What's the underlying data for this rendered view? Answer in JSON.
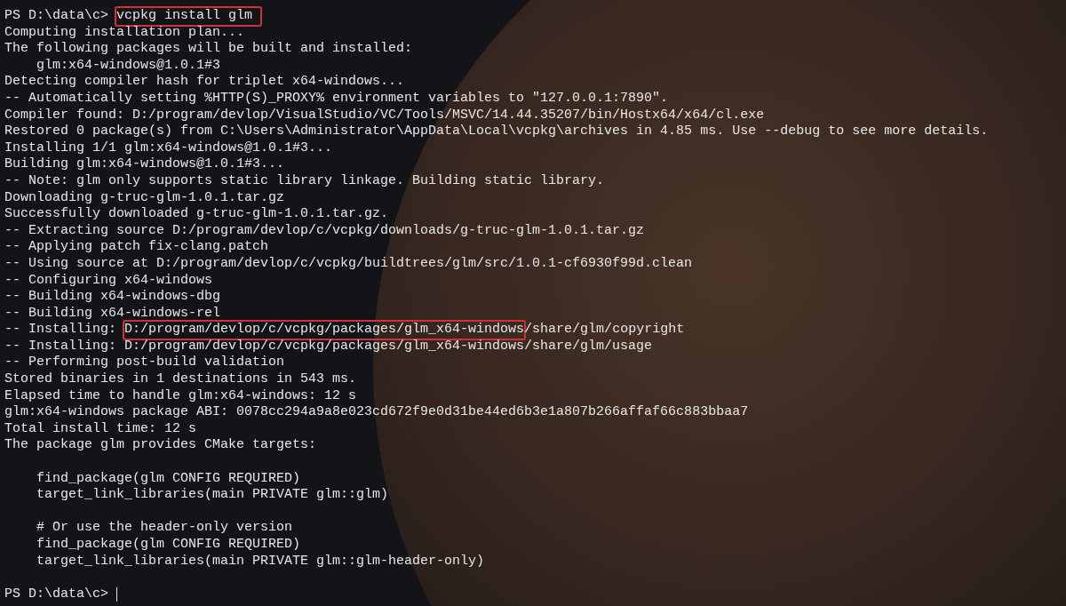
{
  "terminal": {
    "lines": [
      {
        "kind": "text",
        "parts": [
          {
            "text": "PS D:\\data\\c> ",
            "highlighted": false
          },
          {
            "text": "vcpkg install glm ",
            "highlighted": true
          }
        ]
      },
      {
        "kind": "text",
        "parts": [
          {
            "text": "Computing installation plan...",
            "highlighted": false
          }
        ]
      },
      {
        "kind": "text",
        "parts": [
          {
            "text": "The following packages will be built and installed:",
            "highlighted": false
          }
        ]
      },
      {
        "kind": "text",
        "parts": [
          {
            "text": "    glm:x64-windows@1.0.1#3",
            "highlighted": false
          }
        ]
      },
      {
        "kind": "text",
        "parts": [
          {
            "text": "Detecting compiler hash for triplet x64-windows...",
            "highlighted": false
          }
        ]
      },
      {
        "kind": "text",
        "parts": [
          {
            "text": "-- Automatically setting %HTTP(S)_PROXY% environment variables to \"127.0.0.1:7890\".",
            "highlighted": false
          }
        ]
      },
      {
        "kind": "text",
        "parts": [
          {
            "text": "Compiler found: D:/program/devlop/VisualStudio/VC/Tools/MSVC/14.44.35207/bin/Hostx64/x64/cl.exe",
            "highlighted": false
          }
        ]
      },
      {
        "kind": "text",
        "parts": [
          {
            "text": "Restored 0 package(s) from C:\\Users\\Administrator\\AppData\\Local\\vcpkg\\archives in 4.85 ms. Use --debug to see more details.",
            "highlighted": false
          }
        ]
      },
      {
        "kind": "text",
        "parts": [
          {
            "text": "Installing 1/1 glm:x64-windows@1.0.1#3...",
            "highlighted": false
          }
        ]
      },
      {
        "kind": "text",
        "parts": [
          {
            "text": "Building glm:x64-windows@1.0.1#3...",
            "highlighted": false
          }
        ]
      },
      {
        "kind": "text",
        "parts": [
          {
            "text": "-- Note: glm only supports static library linkage. Building static library.",
            "highlighted": false
          }
        ]
      },
      {
        "kind": "text",
        "parts": [
          {
            "text": "Downloading g-truc-glm-1.0.1.tar.gz",
            "highlighted": false
          }
        ]
      },
      {
        "kind": "text",
        "parts": [
          {
            "text": "Successfully downloaded g-truc-glm-1.0.1.tar.gz.",
            "highlighted": false
          }
        ]
      },
      {
        "kind": "text",
        "parts": [
          {
            "text": "-- Extracting source D:/program/devlop/c/vcpkg/downloads/g-truc-glm-1.0.1.tar.gz",
            "highlighted": false
          }
        ]
      },
      {
        "kind": "text",
        "parts": [
          {
            "text": "-- Applying patch fix-clang.patch",
            "highlighted": false
          }
        ]
      },
      {
        "kind": "text",
        "parts": [
          {
            "text": "-- Using source at D:/program/devlop/c/vcpkg/buildtrees/glm/src/1.0.1-cf6930f99d.clean",
            "highlighted": false
          }
        ]
      },
      {
        "kind": "text",
        "parts": [
          {
            "text": "-- Configuring x64-windows",
            "highlighted": false
          }
        ]
      },
      {
        "kind": "text",
        "parts": [
          {
            "text": "-- Building x64-windows-dbg",
            "highlighted": false
          }
        ]
      },
      {
        "kind": "text",
        "parts": [
          {
            "text": "-- Building x64-windows-rel",
            "highlighted": false
          }
        ]
      },
      {
        "kind": "text",
        "parts": [
          {
            "text": "-- Installing: ",
            "highlighted": false
          },
          {
            "text": "D:/program/devlop/c/vcpkg/packages/glm_x64-windows",
            "highlighted": true
          },
          {
            "text": "/share/glm/copyright",
            "highlighted": false
          }
        ]
      },
      {
        "kind": "text",
        "parts": [
          {
            "text": "-- Installing: D:/program/devlop/c/vcpkg/packages/glm_x64-windows/share/glm/usage",
            "highlighted": false
          }
        ]
      },
      {
        "kind": "text",
        "parts": [
          {
            "text": "-- Performing post-build validation",
            "highlighted": false
          }
        ]
      },
      {
        "kind": "text",
        "parts": [
          {
            "text": "Stored binaries in 1 destinations in 543 ms.",
            "highlighted": false
          }
        ]
      },
      {
        "kind": "text",
        "parts": [
          {
            "text": "Elapsed time to handle glm:x64-windows: 12 s",
            "highlighted": false
          }
        ]
      },
      {
        "kind": "text",
        "parts": [
          {
            "text": "glm:x64-windows package ABI: 0078cc294a9a8e023cd672f9e0d31be44ed6b3e1a807b266affaf66c883bbaa7",
            "highlighted": false
          }
        ]
      },
      {
        "kind": "text",
        "parts": [
          {
            "text": "Total install time: 12 s",
            "highlighted": false
          }
        ]
      },
      {
        "kind": "text",
        "parts": [
          {
            "text": "The package glm provides CMake targets:",
            "highlighted": false
          }
        ]
      },
      {
        "kind": "blank"
      },
      {
        "kind": "text",
        "parts": [
          {
            "text": "    find_package(glm CONFIG REQUIRED)",
            "highlighted": false
          }
        ]
      },
      {
        "kind": "text",
        "parts": [
          {
            "text": "    target_link_libraries(main PRIVATE glm::glm)",
            "highlighted": false
          }
        ]
      },
      {
        "kind": "blank"
      },
      {
        "kind": "text",
        "parts": [
          {
            "text": "    # Or use the header-only version",
            "highlighted": false
          }
        ]
      },
      {
        "kind": "text",
        "parts": [
          {
            "text": "    find_package(glm CONFIG REQUIRED)",
            "highlighted": false
          }
        ]
      },
      {
        "kind": "text",
        "parts": [
          {
            "text": "    target_link_libraries(main PRIVATE glm::glm-header-only)",
            "highlighted": false
          }
        ]
      },
      {
        "kind": "blank"
      },
      {
        "kind": "prompt",
        "cursor": true,
        "parts": [
          {
            "text": "PS D:\\data\\c> ",
            "highlighted": false
          }
        ]
      }
    ]
  }
}
